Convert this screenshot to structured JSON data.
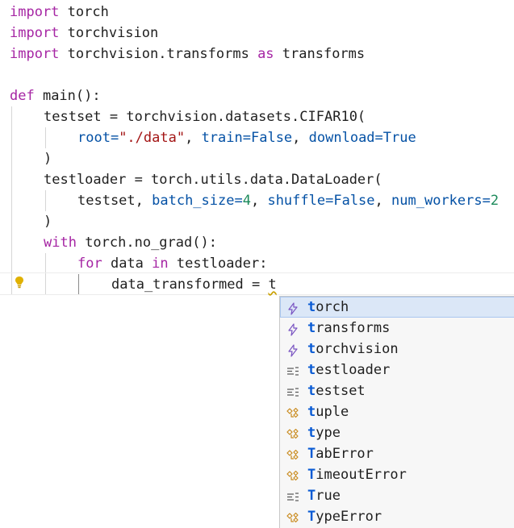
{
  "code": {
    "lines": [
      {
        "kw": "import",
        "rest": " torch"
      },
      {
        "kw": "import",
        "rest": " torchvision"
      },
      {
        "kw": "import",
        "mid": " torchvision.transforms ",
        "kw2": "as",
        "rest": " transforms"
      },
      {},
      {
        "kw": "def",
        "rest": " main():"
      },
      {
        "text": "testset = torchvision.datasets.CIFAR10("
      },
      {
        "arg1_name": "root=",
        "arg1_val": "\"./data\"",
        "sep1": ", ",
        "arg2_name": "train=",
        "arg2_val": "False",
        "sep2": ", ",
        "arg3_name": "download=",
        "arg3_val": "True"
      },
      {
        "text": ")"
      },
      {
        "text": "testloader = torch.utils.data.DataLoader("
      },
      {
        "p1": "testset, ",
        "a1": "batch_size=",
        "v1": "4",
        "p2": ", ",
        "a2": "shuffle=",
        "v2": "False",
        "p3": ", ",
        "a3": "num_workers=",
        "v3": "2"
      },
      {
        "text": ")"
      },
      {
        "kw": "with",
        "rest": " torch.no_grad():"
      },
      {
        "kw": "for",
        "mid": " data ",
        "kw2": "in",
        "rest": " testloader:"
      },
      {
        "text": "data_transformed = ",
        "typed": "t"
      }
    ]
  },
  "suggestions": {
    "items": [
      {
        "icon": "module-icon",
        "match": "t",
        "rest": "orch"
      },
      {
        "icon": "module-icon",
        "match": "t",
        "rest": "ransforms"
      },
      {
        "icon": "module-icon",
        "match": "t",
        "rest": "orchvision"
      },
      {
        "icon": "variable-icon",
        "match": "t",
        "rest": "estloader"
      },
      {
        "icon": "variable-icon",
        "match": "t",
        "rest": "estset"
      },
      {
        "icon": "class-icon",
        "match": "t",
        "rest": "uple"
      },
      {
        "icon": "class-icon",
        "match": "t",
        "rest": "ype"
      },
      {
        "icon": "class-icon",
        "match": "T",
        "rest": "abError"
      },
      {
        "icon": "class-icon",
        "match": "T",
        "rest": "imeoutError"
      },
      {
        "icon": "variable-icon",
        "match": "T",
        "rest": "rue"
      },
      {
        "icon": "class-icon",
        "match": "T",
        "rest": "ypeError"
      }
    ]
  },
  "colors": {
    "keyword": "#a626a4",
    "string": "#a31515",
    "number": "#1b8a5a",
    "boolean": "#0451a5",
    "match_highlight": "#0a5bd4",
    "selected_suggestion": "#dbe7f7"
  }
}
